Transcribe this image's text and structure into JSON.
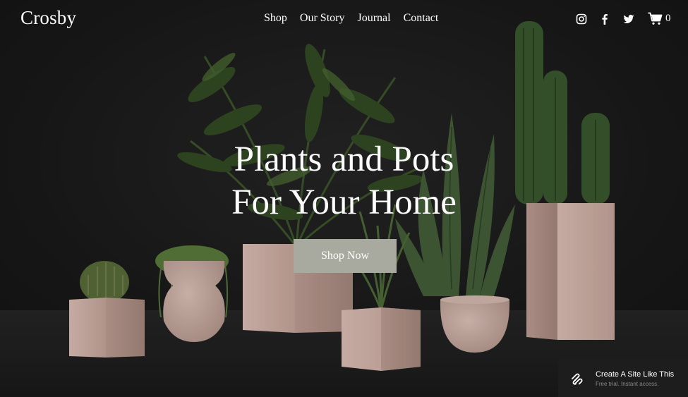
{
  "site": {
    "logo": "Crosby"
  },
  "nav": {
    "items": [
      {
        "label": "Shop"
      },
      {
        "label": "Our Story"
      },
      {
        "label": "Journal"
      },
      {
        "label": "Contact"
      }
    ]
  },
  "social": [
    {
      "icon": "instagram-icon"
    },
    {
      "icon": "facebook-icon"
    },
    {
      "icon": "twitter-icon"
    }
  ],
  "cart": {
    "icon": "cart-icon",
    "count": "0"
  },
  "hero": {
    "headline_line1": "Plants and Pots",
    "headline_line2": "For Your Home",
    "cta_label": "Shop Now"
  },
  "promo": {
    "icon": "squarespace-logo-icon",
    "title": "Create A Site Like This",
    "subtitle": "Free trial. Instant access."
  },
  "colors": {
    "background": "#1b1b1b",
    "text": "#ffffff",
    "cta_background": "#a8aa9f",
    "pot_pink": "#dcbcb2",
    "promo_background": "#1d1d1d",
    "promo_subtext": "#8a8a8a"
  }
}
